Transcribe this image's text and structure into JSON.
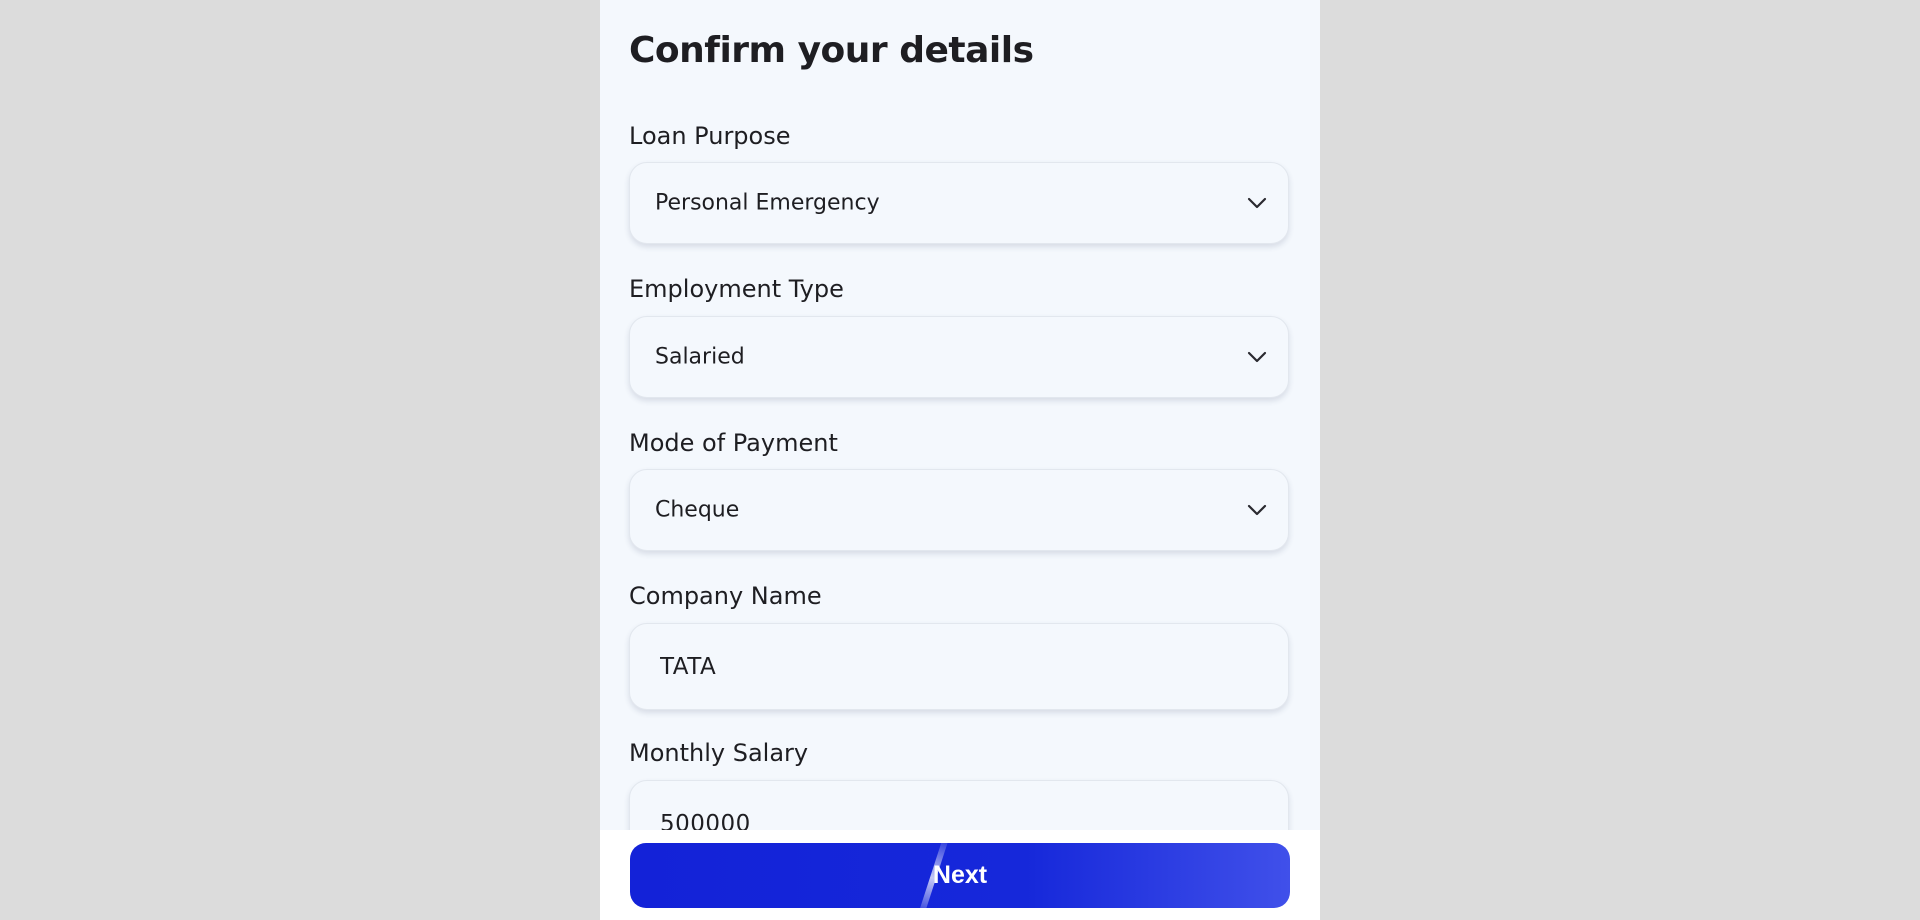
{
  "page": {
    "title": "Confirm your details"
  },
  "form": {
    "loan_purpose": {
      "label": "Loan Purpose",
      "value": "Personal Emergency"
    },
    "employment_type": {
      "label": "Employment Type",
      "value": "Salaried"
    },
    "mode_of_payment": {
      "label": "Mode of Payment",
      "value": "Cheque"
    },
    "company_name": {
      "label": "Company Name",
      "value": "TATA"
    },
    "monthly_salary": {
      "label": "Monthly Salary",
      "value": "500000"
    }
  },
  "footer": {
    "next_label": "Next"
  },
  "colors": {
    "background": "#dcdcdc",
    "panel": "#f4f8fd",
    "button_primary": "#1322d8",
    "button_gradient_end": "#4050ea",
    "text": "#1e1e22"
  },
  "icons": {
    "select_chevron": "chevron-down-icon"
  }
}
